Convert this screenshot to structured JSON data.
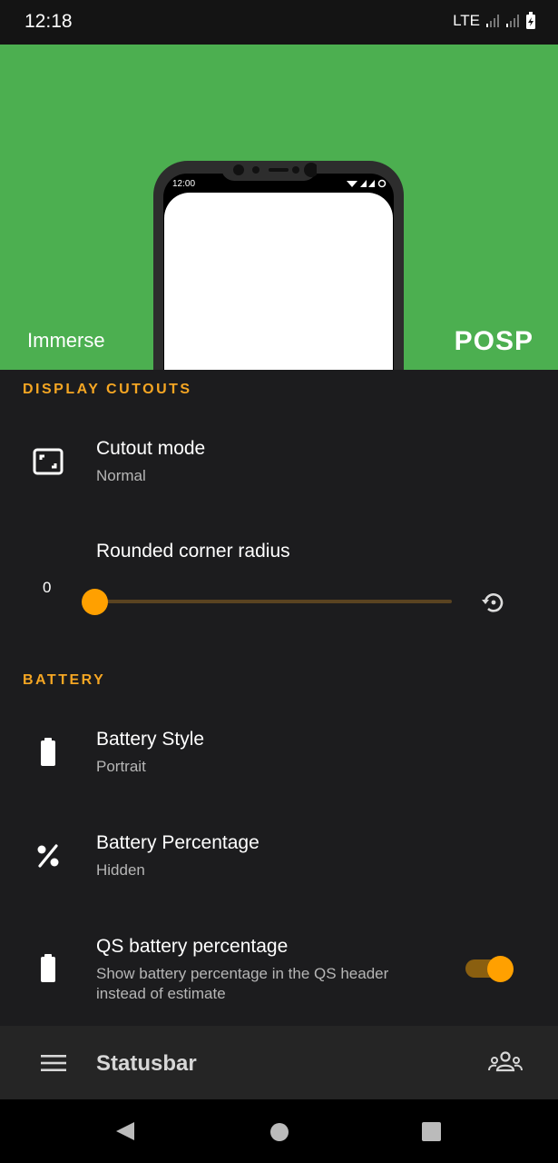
{
  "status_bar": {
    "time": "12:18",
    "network": "LTE"
  },
  "hero": {
    "left_label": "Immerse",
    "brand": "POSP",
    "phone_time": "12:00"
  },
  "sections": {
    "display_cutouts": {
      "title": "DISPLAY CUTOUTS",
      "cutout_mode": {
        "title": "Cutout mode",
        "value": "Normal",
        "icon": "cutout-icon"
      },
      "corner_radius": {
        "title": "Rounded corner radius",
        "value": "0",
        "fraction": 0,
        "icon": "reset-icon"
      }
    },
    "battery": {
      "title": "BATTERY",
      "style": {
        "title": "Battery Style",
        "value": "Portrait",
        "icon": "battery-icon"
      },
      "percentage": {
        "title": "Battery Percentage",
        "value": "Hidden",
        "icon": "percent-icon"
      },
      "qs_percentage": {
        "title": "QS battery percentage",
        "summary": "Show battery percentage in the QS header instead of estimate",
        "enabled": true,
        "icon": "battery-icon"
      }
    }
  },
  "bottom_bar": {
    "title": "Statusbar",
    "menu_icon": "menu-icon",
    "action_icon": "people-icon"
  },
  "colors": {
    "accent": "#ffa000",
    "section_title": "#f5a623",
    "hero_bg": "#4caf50",
    "bg": "#1c1c1e"
  }
}
